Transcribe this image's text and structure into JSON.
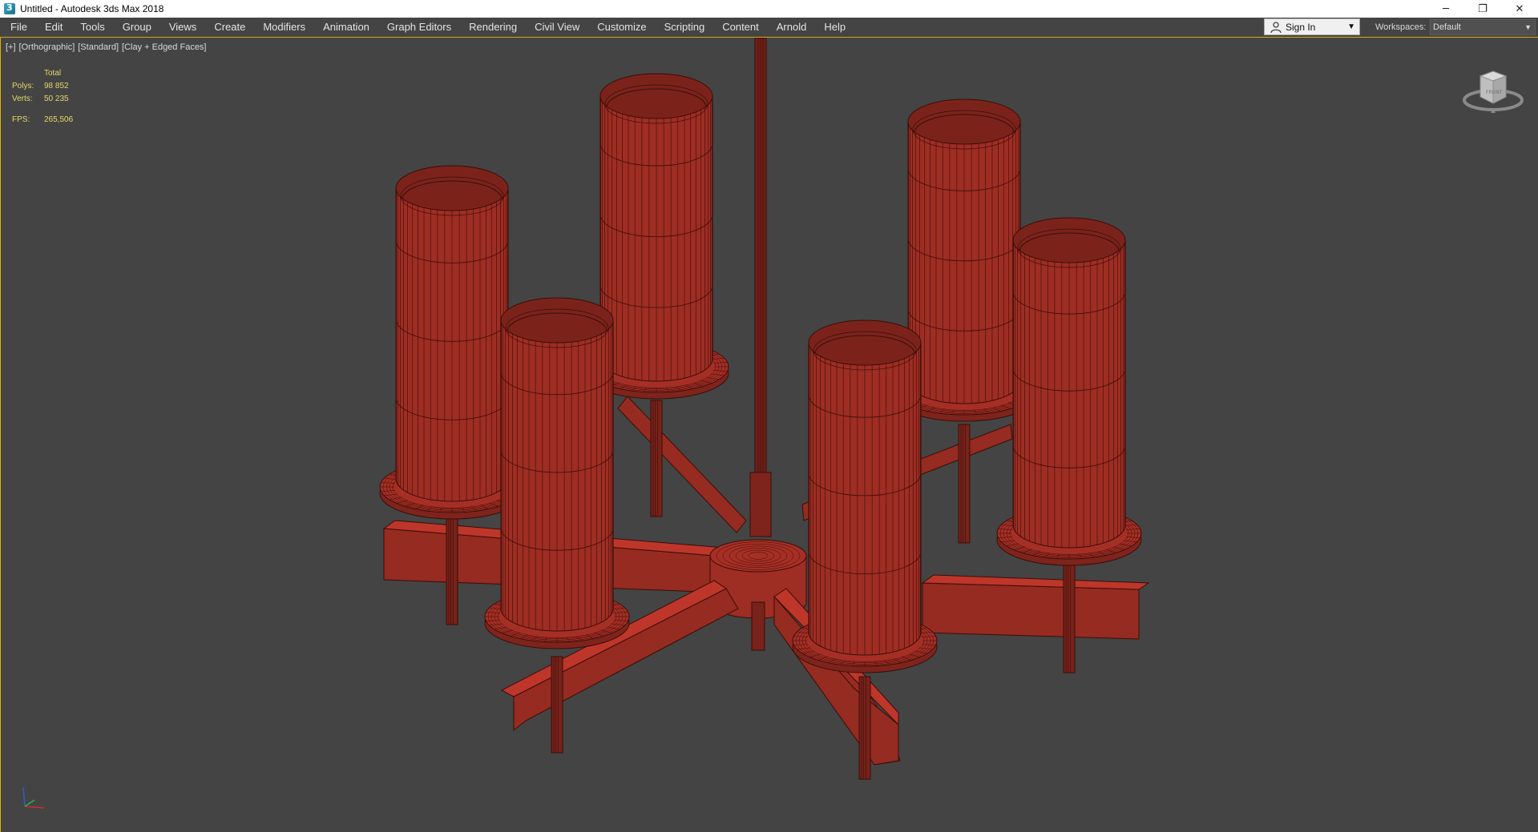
{
  "window": {
    "title": "Untitled - Autodesk 3ds Max 2018",
    "controls": [
      "─",
      "❐",
      "✕"
    ]
  },
  "menu": {
    "items": [
      "File",
      "Edit",
      "Tools",
      "Group",
      "Views",
      "Create",
      "Modifiers",
      "Animation",
      "Graph Editors",
      "Rendering",
      "Civil View",
      "Customize",
      "Scripting",
      "Content",
      "Arnold",
      "Help"
    ],
    "sign_in": "Sign In",
    "workspaces_label": "Workspaces:",
    "workspaces_value": "Default"
  },
  "viewport": {
    "labels": [
      "[+]",
      "[Orthographic]",
      "[Standard]",
      "[Clay + Edged Faces]"
    ],
    "stats": {
      "total_label": "Total",
      "polys_label": "Polys:",
      "polys_value": "98 852",
      "verts_label": "Verts:",
      "verts_value": "50 235",
      "fps_label": "FPS:",
      "fps_value": "265,506"
    },
    "viewcube_face": "FRONT",
    "model_color": "#9e2d23",
    "edge_color": "#3a0d08"
  }
}
